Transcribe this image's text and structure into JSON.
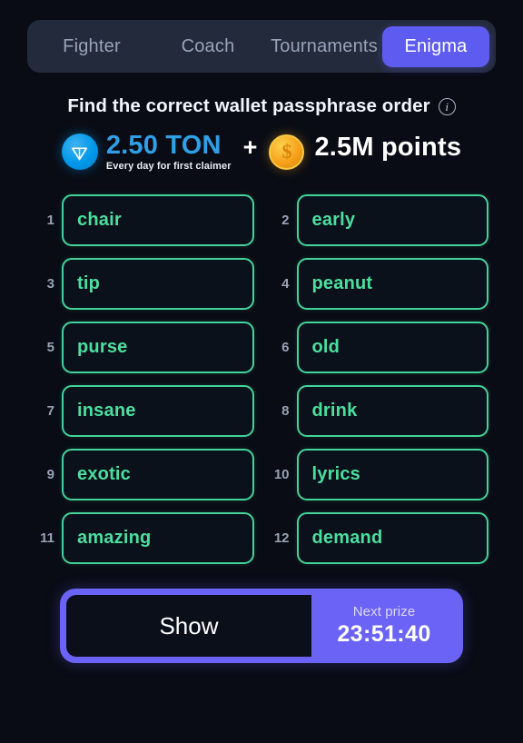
{
  "tabs": [
    {
      "label": "Fighter",
      "active": false
    },
    {
      "label": "Coach",
      "active": false
    },
    {
      "label": "Tournaments",
      "active": false
    },
    {
      "label": "Enigma",
      "active": true
    }
  ],
  "header": {
    "title": "Find the correct wallet passphrase order",
    "info_icon": "info-circle-icon"
  },
  "prize": {
    "ton_icon": "ton-coin-icon",
    "ton_amount": "2.50 TON",
    "ton_subtitle": "Every day for first claimer",
    "separator": "+",
    "points_icon": "dollar-coin-icon",
    "points_amount": "2.5M points"
  },
  "words": [
    {
      "index": "1",
      "word": "chair"
    },
    {
      "index": "2",
      "word": "early"
    },
    {
      "index": "3",
      "word": "tip"
    },
    {
      "index": "4",
      "word": "peanut"
    },
    {
      "index": "5",
      "word": "purse"
    },
    {
      "index": "6",
      "word": "old"
    },
    {
      "index": "7",
      "word": "insane"
    },
    {
      "index": "8",
      "word": "drink"
    },
    {
      "index": "9",
      "word": "exotic"
    },
    {
      "index": "10",
      "word": "lyrics"
    },
    {
      "index": "11",
      "word": "amazing"
    },
    {
      "index": "12",
      "word": "demand"
    }
  ],
  "action": {
    "show_label": "Show",
    "next_prize_label": "Next prize",
    "timer": "23:51:40"
  },
  "colors": {
    "background": "#090c15",
    "tabbar": "#232a3b",
    "accent_purple": "#5e5cf0",
    "word_green": "#4adf9f",
    "ton_blue": "#2f9fe8",
    "coin_gold": "#f5a019"
  }
}
